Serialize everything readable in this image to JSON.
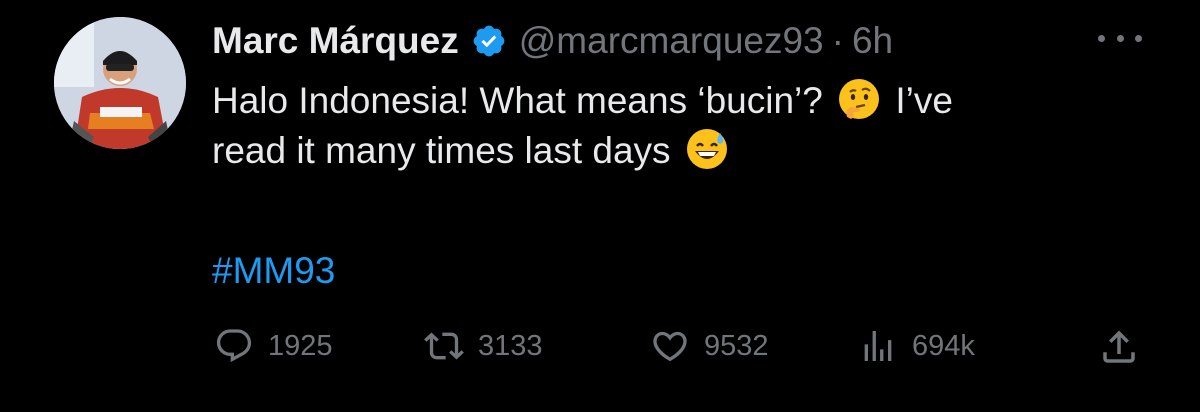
{
  "tweet": {
    "author_name": "Marc Márquez",
    "handle": "@marcmarquez93",
    "separator": "·",
    "time": "6h",
    "text_part1": "Halo Indonesia! What means ‘bucin’? ",
    "text_part2": " I’ve\nread it many times last days ",
    "hashtag": "#MM93"
  },
  "actions": {
    "replies": "1925",
    "reposts": "3133",
    "likes": "9532",
    "views": "694k"
  },
  "icons": {
    "verified": "verified-badge-icon",
    "more": "more-icon",
    "emoji1": "thinking-face-emoji",
    "emoji2": "grinning-sweat-emoji",
    "reply": "reply-icon",
    "repost": "repost-icon",
    "like": "heart-icon",
    "views": "views-icon",
    "share": "share-icon"
  },
  "colors": {
    "background": "#000000",
    "text": "#e7e9ea",
    "muted": "#71767b",
    "link": "#1d9bf0",
    "verified": "#1d9bf0"
  }
}
